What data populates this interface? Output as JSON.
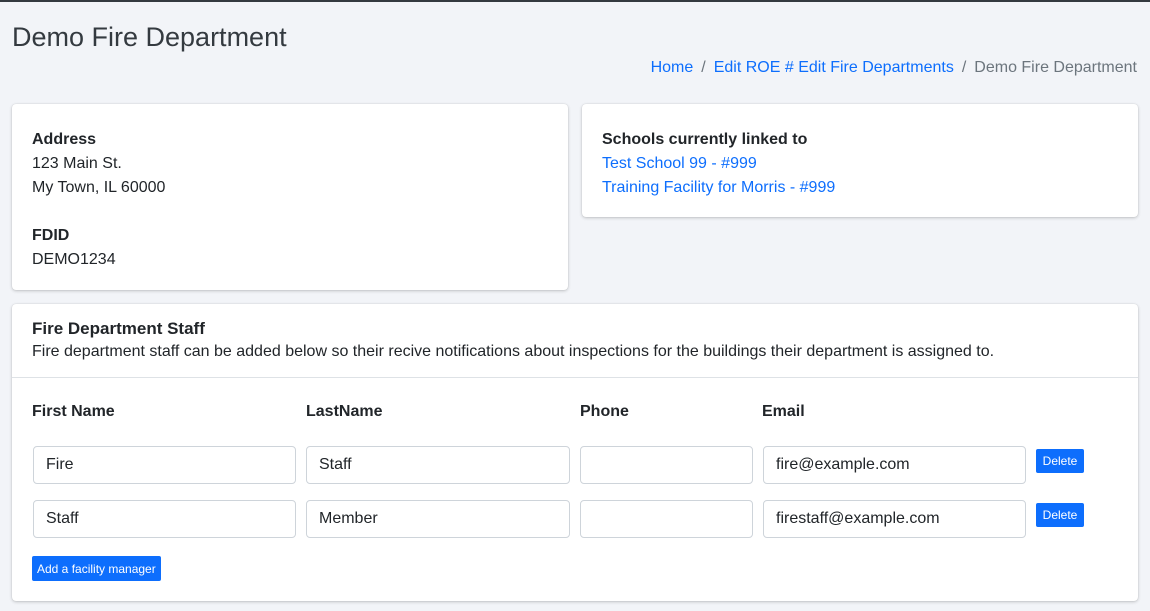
{
  "page": {
    "title": "Demo Fire Department"
  },
  "breadcrumb": {
    "home": "Home",
    "edit_roe": "Edit ROE # Edit Fire Departments",
    "current": "Demo Fire Department",
    "separator": "/"
  },
  "address_card": {
    "address_label": "Address",
    "address_line1": "123 Main St.",
    "address_line2": "My Town, IL 60000",
    "fdid_label": "FDID",
    "fdid_value": "DEMO1234"
  },
  "schools_card": {
    "label": "Schools currently linked to",
    "schools": [
      "Test School 99 - #999",
      "Training Facility for Morris - #999"
    ]
  },
  "staff_card": {
    "title": "Fire Department Staff",
    "description": "Fire department staff can be added below so their recive notifications about inspections for the buildings their department is assigned to.",
    "columns": {
      "first_name": "First Name",
      "last_name": "LastName",
      "phone": "Phone",
      "email": "Email"
    },
    "rows": [
      {
        "first_name": "Fire",
        "last_name": "Staff",
        "phone": "",
        "email": "fire@example.com"
      },
      {
        "first_name": "Staff",
        "last_name": "Member",
        "phone": "",
        "email": "firestaff@example.com"
      }
    ],
    "delete_label": "Delete",
    "add_label": "Add a facility manager"
  },
  "colors": {
    "accent": "#0d6efd",
    "background": "#f2f4f8"
  }
}
